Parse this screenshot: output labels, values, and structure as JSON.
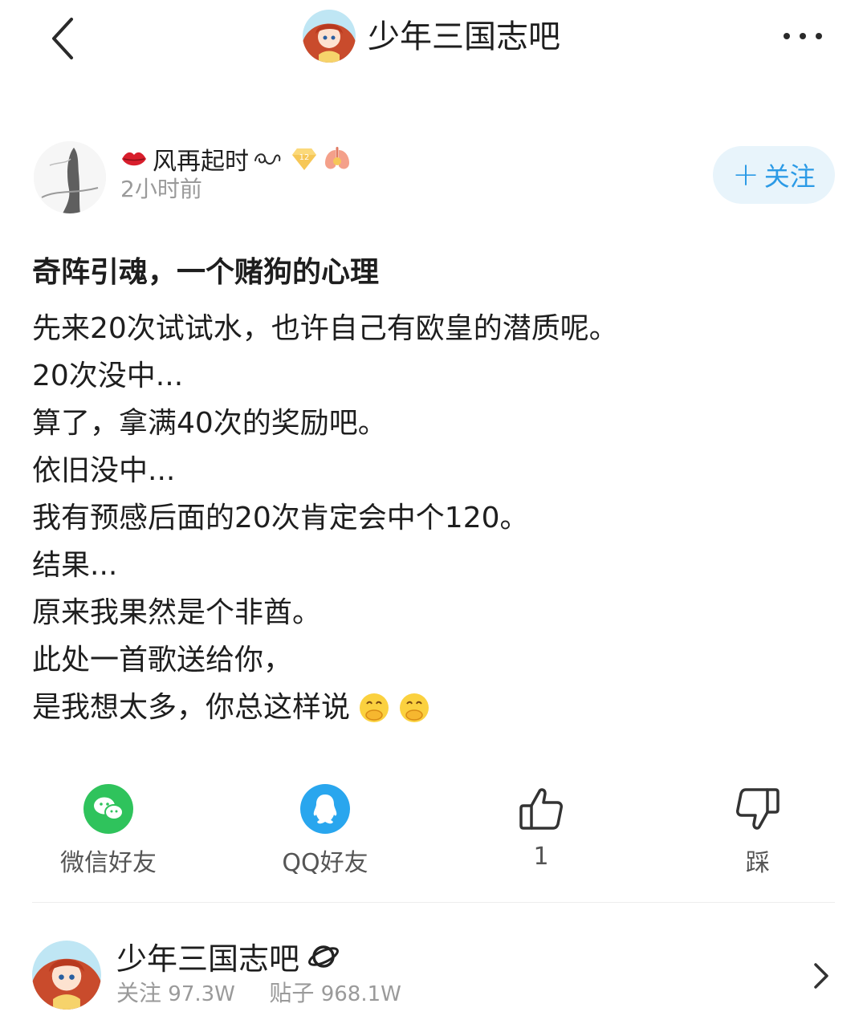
{
  "header": {
    "title": "少年三国志吧"
  },
  "author": {
    "name": "风再起时",
    "time": "2小时前",
    "level_badge": "12",
    "follow_label": "关注",
    "follow_plus": "+"
  },
  "post": {
    "title": "奇阵引魂，一个赌狗的心理",
    "lines": [
      "先来20次试试水，也许自己有欧皇的潜质呢。",
      "20次没中...",
      "算了，拿满40次的奖励吧。",
      "依旧没中...",
      "我有预感后面的20次肯定会中个120。",
      "结果...",
      "原来我果然是个非酋。",
      "此处一首歌送给你，",
      "是我想太多，你总这样说"
    ]
  },
  "actions": {
    "wechat": "微信好友",
    "qq": "QQ好友",
    "like_count": "1",
    "dislike": "踩"
  },
  "forum": {
    "name": "少年三国志吧",
    "follow_label": "关注",
    "follow_count": "97.3W",
    "posts_label": "贴子",
    "posts_count": "968.1W"
  },
  "colors": {
    "accent": "#2b9ae6",
    "follow_bg": "#e8f4fb",
    "wechat_green": "#2fc35c",
    "qq_blue": "#29a6ee",
    "muted_text": "#9a9a9a"
  }
}
